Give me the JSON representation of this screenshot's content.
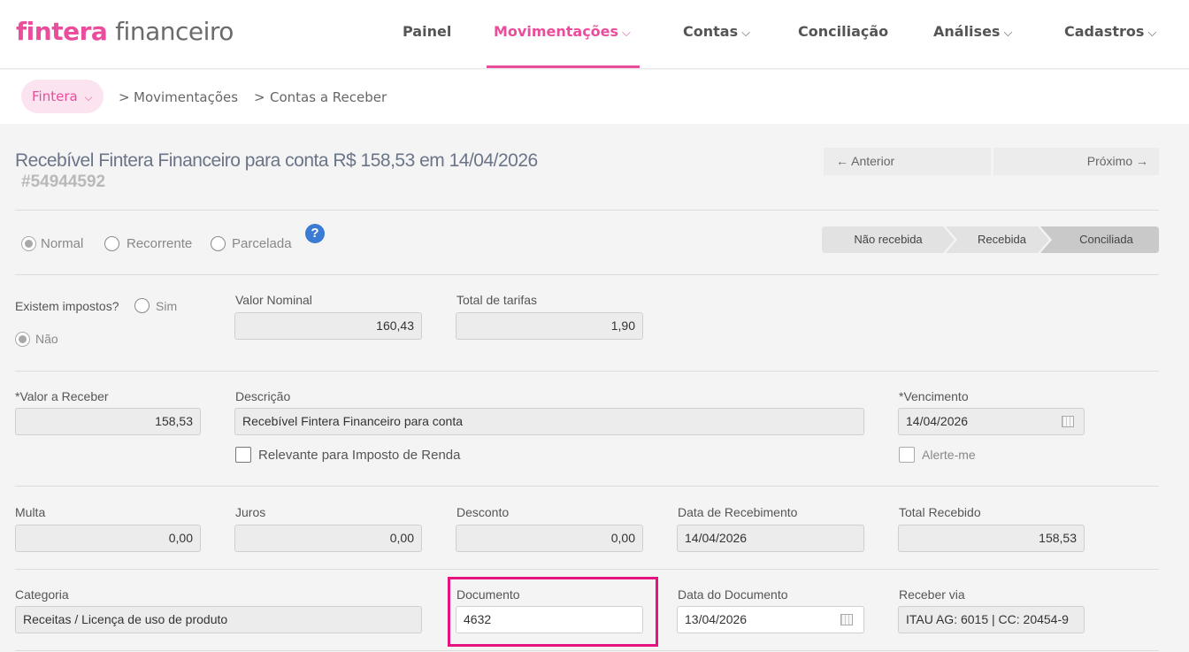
{
  "header": {
    "logo_brand": "fintera",
    "logo_product": "financeiro",
    "nav": [
      {
        "label": "Painel",
        "chevron": ""
      },
      {
        "label": "Movimentações",
        "chevron": "⌵"
      },
      {
        "label": "Contas",
        "chevron": "⌵"
      },
      {
        "label": "Conciliação",
        "chevron": ""
      },
      {
        "label": "Análises",
        "chevron": "⌵"
      },
      {
        "label": "Cadastros",
        "chevron": "⌵"
      }
    ]
  },
  "breadcrumb": {
    "root": "Fintera",
    "root_chevron": "⌵",
    "items": [
      "Movimentações",
      "Contas a Receber"
    ],
    "separator": ">"
  },
  "record": {
    "title": "Recebível Fintera Financeiro para conta R$ 158,53 em 14/04/2026",
    "id": "#54944592",
    "prev_label": "← Anterior",
    "next_label": "Próximo →"
  },
  "type_options": [
    "Normal",
    "Recorrente",
    "Parcelada"
  ],
  "help_glyph": "?",
  "status_steps": [
    "Não recebida",
    "Recebida",
    "Conciliada"
  ],
  "taxes": {
    "question": "Existem impostos?",
    "yes": "Sim",
    "no": "Não",
    "valor_nominal_label": "Valor Nominal",
    "valor_nominal": "160,43",
    "total_tarifas_label": "Total de tarifas",
    "total_tarifas": "1,90"
  },
  "main": {
    "valor_receber_label": "*Valor a Receber",
    "valor_receber": "158,53",
    "descricao_label": "Descrição",
    "descricao": "Recebível Fintera Financeiro para conta",
    "ir_label": "Relevante para Imposto de Renda",
    "vencimento_label": "*Vencimento",
    "vencimento": "14/04/2026",
    "alerte_label": "Alerte-me"
  },
  "payment": {
    "multa_label": "Multa",
    "multa": "0,00",
    "juros_label": "Juros",
    "juros": "0,00",
    "desconto_label": "Desconto",
    "desconto": "0,00",
    "data_recebimento_label": "Data de Recebimento",
    "data_recebimento": "14/04/2026",
    "total_recebido_label": "Total Recebido",
    "total_recebido": "158,53"
  },
  "doc": {
    "categoria_label": "Categoria",
    "categoria": "Receitas / Licença de uso de produto",
    "documento_label": "Documento",
    "documento": "4632",
    "data_documento_label": "Data do Documento",
    "data_documento": "13/04/2026",
    "receber_via_label": "Receber via",
    "receber_via": "ITAU AG: 6015 | CC: 20454-9"
  },
  "colors": {
    "brand": "#ea4d9c",
    "highlight": "#e4137f",
    "help": "#3b7bd4"
  }
}
